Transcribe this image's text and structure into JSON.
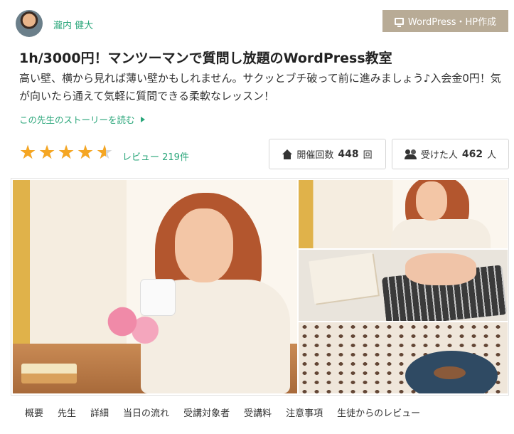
{
  "teacher": {
    "name": "瀧内 健大"
  },
  "badge": {
    "category": "WordPress・HP作成",
    "icon": "monitor-icon"
  },
  "lesson": {
    "title": "1h/3000円！マンツーマンで質問し放題のWordPress教室",
    "description": "高い壁、横から見れば薄い壁かもしれません。サクッとブチ破って前に進みましょう♪入会金0円！気が向いたら通えて気軽に質問できる柔軟なレッスン！",
    "story_link": "この先生のストーリーを読む"
  },
  "rating": {
    "value": 4.5,
    "max": 5,
    "review_link": "レビュー 219件"
  },
  "stats": {
    "lessons_label": "開催回数",
    "lessons_count": "448",
    "lessons_unit": "回",
    "students_label": "受けた人",
    "students_count": "462",
    "students_unit": "人"
  },
  "tabs": [
    {
      "label": "概要"
    },
    {
      "label": "先生"
    },
    {
      "label": "詳細"
    },
    {
      "label": "当日の流れ"
    },
    {
      "label": "受講対象者"
    },
    {
      "label": "受講料"
    },
    {
      "label": "注意事項"
    },
    {
      "label": "生徒からのレビュー"
    }
  ],
  "colors": {
    "accent": "#2aa67a",
    "star": "#f5a623",
    "badge_bg": "#b8ab96"
  }
}
